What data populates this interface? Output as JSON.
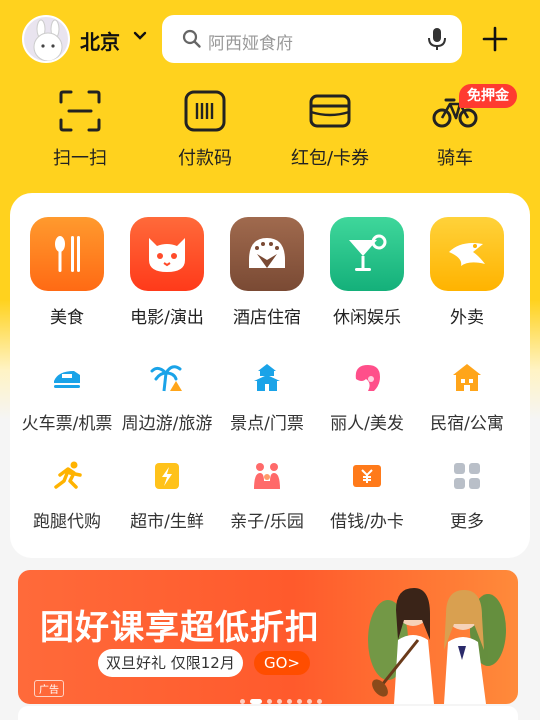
{
  "header": {
    "city": "北京",
    "search_placeholder": "阿西娅食府"
  },
  "top_actions": [
    {
      "label": "扫一扫",
      "icon": "scan-icon"
    },
    {
      "label": "付款码",
      "icon": "barcode-icon"
    },
    {
      "label": "红包/卡券",
      "icon": "wallet-icon"
    },
    {
      "label": "骑车",
      "icon": "bicycle-icon"
    }
  ],
  "badge": "免押金",
  "categories": [
    {
      "label": "美食",
      "icon": "food-icon",
      "color": "#ff7a1f"
    },
    {
      "label": "电影/演出",
      "icon": "cat-icon",
      "color": "#ff4b2b"
    },
    {
      "label": "酒店住宿",
      "icon": "hotel-icon",
      "color": "#8b5a42"
    },
    {
      "label": "休闲娱乐",
      "icon": "cocktail-icon",
      "color": "#22c58b"
    },
    {
      "label": "外卖",
      "icon": "delivery-icon",
      "color": "#ffc21a"
    }
  ],
  "services_row1": [
    {
      "label": "火车票/机票",
      "icon": "train-icon"
    },
    {
      "label": "周边游/旅游",
      "icon": "palm-tree-icon"
    },
    {
      "label": "景点/门票",
      "icon": "temple-icon"
    },
    {
      "label": "丽人/美发",
      "icon": "hair-icon"
    },
    {
      "label": "民宿/公寓",
      "icon": "house-icon"
    }
  ],
  "services_row2": [
    {
      "label": "跑腿代购",
      "icon": "runner-icon"
    },
    {
      "label": "超市/生鲜",
      "icon": "supermarket-icon"
    },
    {
      "label": "亲子/乐园",
      "icon": "family-icon"
    },
    {
      "label": "借钱/办卡",
      "icon": "loan-icon"
    },
    {
      "label": "更多",
      "icon": "more-icon"
    }
  ],
  "banner": {
    "title": "团好课享超低折扣",
    "subtitle": "双旦好礼 仅限12月",
    "cta": "GO>",
    "ad_label": "广告",
    "page_count": 8,
    "active_page": 1
  }
}
